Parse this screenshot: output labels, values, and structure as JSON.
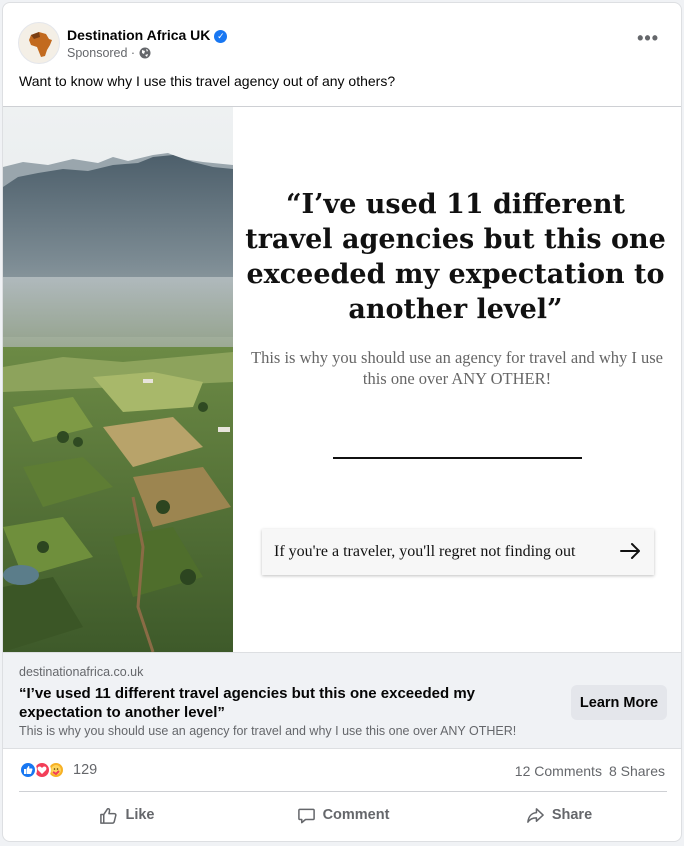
{
  "post": {
    "page_name": "Destination Africa UK",
    "sponsored": "Sponsored ·",
    "text": "Want to know why I use this travel agency out of any others?"
  },
  "creative": {
    "quote": "“I’ve used 11 different travel agencies but this one exceeded my expectation to another level”",
    "subtext": "This is why you should use an agency for travel and why I use this one over ANY OTHER!",
    "cta": "If you're a traveler, you'll regret not finding out"
  },
  "link": {
    "domain": "destinationafrica.co.uk",
    "title": "“I’ve used 11 different travel agencies but this one exceeded my expectation to another level”",
    "description": "This is why you should use an agency for travel and why I use this one over ANY OTHER!",
    "button": "Learn More"
  },
  "engagement": {
    "reaction_count": "129",
    "comments": "12 Comments",
    "shares": "8 Shares"
  },
  "actions": {
    "like": "Like",
    "comment": "Comment",
    "share": "Share"
  },
  "colors": {
    "accent": "#1877f2",
    "love": "#f33e58",
    "care": "#f7b125"
  }
}
